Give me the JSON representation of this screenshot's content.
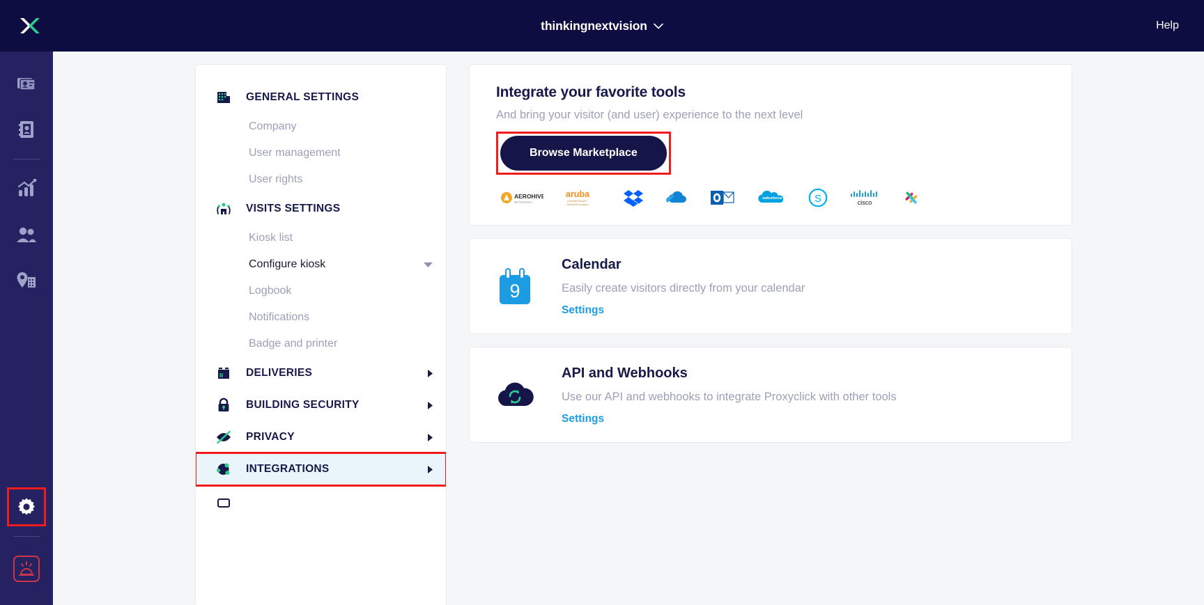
{
  "topbar": {
    "logo_name": "proxyclick-logo",
    "org_name": "thinkingnextvision",
    "help_label": "Help"
  },
  "rail": {
    "items": [
      {
        "icon": "badge-cards-icon",
        "name": "rail-item-visits"
      },
      {
        "icon": "address-book-icon",
        "name": "rail-item-directory"
      },
      {
        "icon": "analytics-chart-icon",
        "name": "rail-item-analytics"
      },
      {
        "icon": "people-icon",
        "name": "rail-item-people"
      },
      {
        "icon": "location-building-icon",
        "name": "rail-item-locations"
      },
      {
        "icon": "gear-icon",
        "name": "rail-item-settings"
      },
      {
        "icon": "emergency-alarm-icon",
        "name": "rail-item-emergency"
      }
    ]
  },
  "nav": {
    "sections": [
      {
        "label": "GENERAL SETTINGS",
        "icon": "building-icon",
        "name": "nav-section-general-settings",
        "items": [
          {
            "label": "Company",
            "name": "nav-item-company",
            "active": false,
            "caret": false
          },
          {
            "label": "User management",
            "name": "nav-item-user-management",
            "active": false,
            "caret": false
          },
          {
            "label": "User rights",
            "name": "nav-item-user-rights",
            "active": false,
            "caret": false
          }
        ]
      },
      {
        "label": "VISITS SETTINGS",
        "icon": "visitors-icon",
        "name": "nav-section-visits-settings",
        "items": [
          {
            "label": "Kiosk list",
            "name": "nav-item-kiosk-list",
            "active": false,
            "caret": false
          },
          {
            "label": "Configure kiosk",
            "name": "nav-item-configure-kiosk",
            "active": true,
            "caret": true
          },
          {
            "label": "Logbook",
            "name": "nav-item-logbook",
            "active": false,
            "caret": false
          },
          {
            "label": "Notifications",
            "name": "nav-item-notifications",
            "active": false,
            "caret": false
          },
          {
            "label": "Badge and printer",
            "name": "nav-item-badge-and-printer",
            "active": false,
            "caret": false
          }
        ]
      },
      {
        "label": "DELIVERIES",
        "icon": "package-icon",
        "name": "nav-section-deliveries",
        "arrow": true,
        "items": []
      },
      {
        "label": "BUILDING SECURITY",
        "icon": "padlock-icon",
        "name": "nav-section-building-security",
        "arrow": true,
        "items": []
      },
      {
        "label": "PRIVACY",
        "icon": "eye-slash-icon",
        "name": "nav-section-privacy",
        "arrow": true,
        "items": []
      },
      {
        "label": "INTEGRATIONS",
        "icon": "puzzle-icon",
        "name": "nav-section-integrations",
        "arrow": true,
        "selected": true,
        "items": []
      }
    ]
  },
  "promo": {
    "title": "Integrate your favorite tools",
    "subtitle": "And bring your visitor (and user) experience to the next level",
    "button_label": "Browse Marketplace",
    "partner_logos": [
      {
        "name": "aerohive-logo",
        "label": "AEROHIVE"
      },
      {
        "name": "aruba-logo",
        "label": "aruba"
      },
      {
        "name": "dropbox-logo",
        "label": "Dropbox"
      },
      {
        "name": "onedrive-logo",
        "label": "OneDrive"
      },
      {
        "name": "outlook-logo",
        "label": "Outlook"
      },
      {
        "name": "salesforce-logo",
        "label": "salesforce"
      },
      {
        "name": "skype-logo",
        "label": "Skype"
      },
      {
        "name": "cisco-logo",
        "label": "cisco"
      },
      {
        "name": "slack-logo",
        "label": "Slack"
      }
    ]
  },
  "integrations": [
    {
      "title": "Calendar",
      "description": "Easily create visitors directly from your calendar",
      "link_label": "Settings",
      "icon": "calendar-icon",
      "icon_day": "9",
      "name": "integration-card-calendar"
    },
    {
      "title": "API and Webhooks",
      "description": "Use our API and webhooks to integrate Proxyclick with other tools",
      "link_label": "Settings",
      "icon": "cloud-sync-icon",
      "name": "integration-card-api-and-webhooks"
    }
  ],
  "colors": {
    "topbar_navy": "#0d0d42",
    "rail_navy": "#262261",
    "accent_green": "#2ecc8f",
    "link_blue": "#1b9ce3",
    "highlight_blue": "#e9f4fb",
    "annotation_red": "#f31b1b",
    "muted_text": "#9ca0b8",
    "heading_navy": "#17194a"
  }
}
